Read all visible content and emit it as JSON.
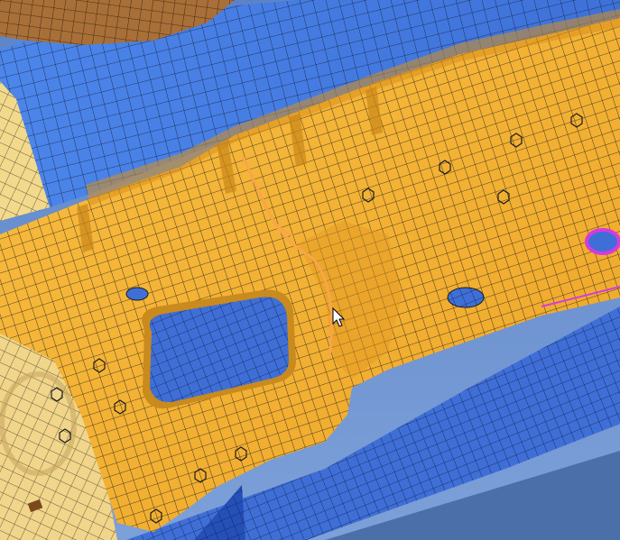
{
  "viewport": {
    "kind": "3D finite-element mesh view",
    "parts": [
      {
        "id": "blue-upper-panel",
        "color": "#4f82e0"
      },
      {
        "id": "brown-upper-part",
        "color": "#a86f38"
      },
      {
        "id": "cream-left-part",
        "color": "#f0d58a"
      },
      {
        "id": "orange-bracket",
        "color": "#f6b334"
      },
      {
        "id": "blue-lower-panel",
        "color": "#3f6fd6"
      },
      {
        "id": "dark-blue-flange",
        "color": "#2550b8"
      }
    ],
    "mesh_line_color": "#1f1f1f",
    "highlight_colors": {
      "selected-edge": "#d63adf",
      "weld-line": "#f8a648"
    }
  },
  "cursor": {
    "type": "arrow-pointer-icon"
  }
}
